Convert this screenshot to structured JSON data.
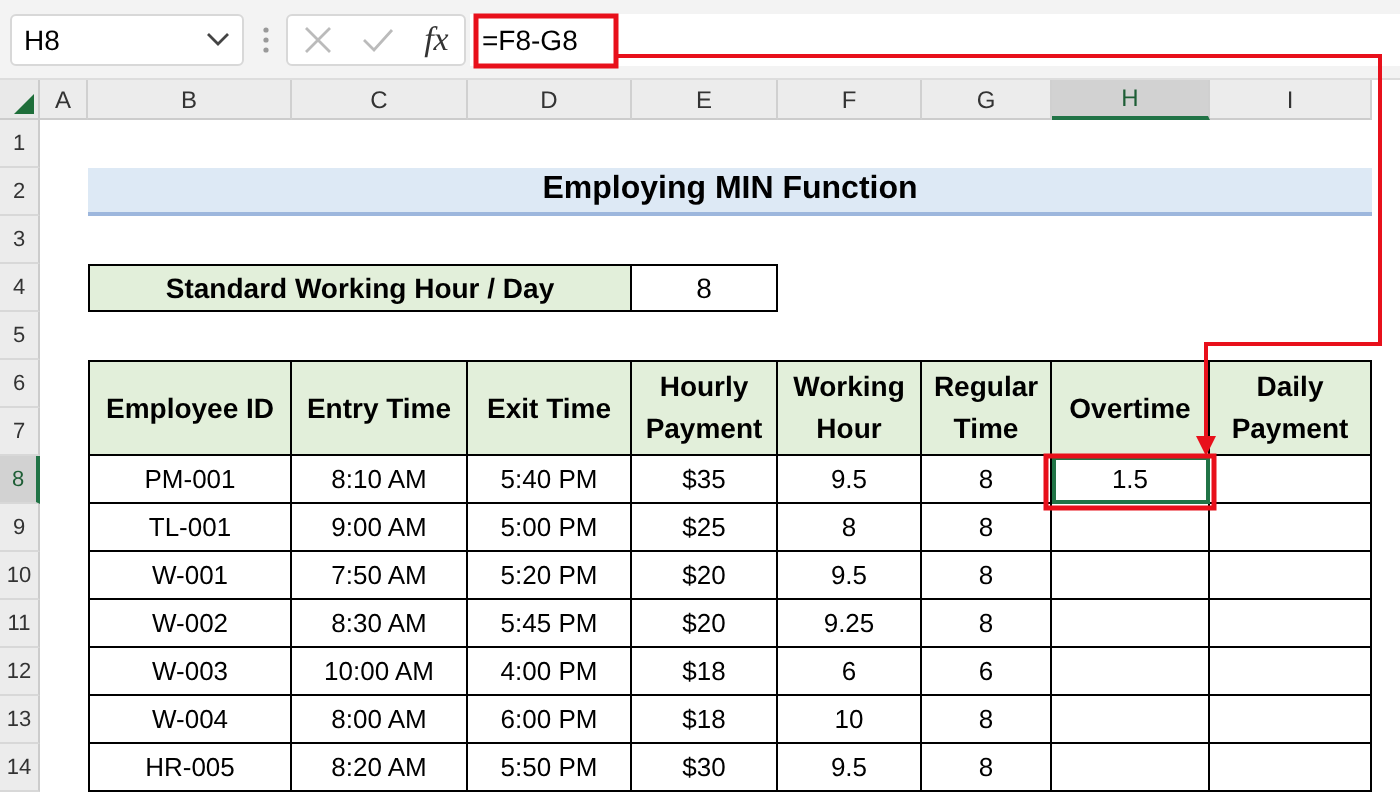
{
  "formula_bar": {
    "name_box": "H8",
    "function_label": "fx",
    "formula": "=F8-G8"
  },
  "columns": [
    {
      "label": "A",
      "selected": false
    },
    {
      "label": "B",
      "selected": false
    },
    {
      "label": "C",
      "selected": false
    },
    {
      "label": "D",
      "selected": false
    },
    {
      "label": "E",
      "selected": false
    },
    {
      "label": "F",
      "selected": false
    },
    {
      "label": "G",
      "selected": false
    },
    {
      "label": "H",
      "selected": true
    },
    {
      "label": "I",
      "selected": false
    }
  ],
  "row_numbers": [
    {
      "label": "1",
      "selected": false
    },
    {
      "label": "2",
      "selected": false
    },
    {
      "label": "3",
      "selected": false
    },
    {
      "label": "4",
      "selected": false
    },
    {
      "label": "5",
      "selected": false
    },
    {
      "label": "6",
      "selected": false
    },
    {
      "label": "7",
      "selected": false
    },
    {
      "label": "8",
      "selected": true
    },
    {
      "label": "9",
      "selected": false
    },
    {
      "label": "10",
      "selected": false
    },
    {
      "label": "11",
      "selected": false
    },
    {
      "label": "12",
      "selected": false
    },
    {
      "label": "13",
      "selected": false
    },
    {
      "label": "14",
      "selected": false
    }
  ],
  "title": "Employing MIN Function",
  "standard": {
    "label": "Standard Working Hour / Day",
    "value": "8"
  },
  "table": {
    "headers": [
      "Employee ID",
      "Entry Time",
      "Exit Time",
      "Hourly Payment",
      "Working Hour",
      "Regular Time",
      "Overtime",
      "Daily Payment"
    ],
    "rows": [
      {
        "id": "PM-001",
        "entry": "8:10 AM",
        "exit": "5:40 PM",
        "hourly": "$35",
        "working": "9.5",
        "regular": "8",
        "overtime": "1.5",
        "overtime_selected": true
      },
      {
        "id": "TL-001",
        "entry": "9:00 AM",
        "exit": "5:00 PM",
        "hourly": "$25",
        "working": "8",
        "regular": "8",
        "overtime_selected": false
      },
      {
        "id": "W-001",
        "entry": "7:50 AM",
        "exit": "5:20 PM",
        "hourly": "$20",
        "working": "9.5",
        "regular": "8",
        "overtime_selected": false
      },
      {
        "id": "W-002",
        "entry": "8:30 AM",
        "exit": "5:45 PM",
        "hourly": "$20",
        "working": "9.25",
        "regular": "8",
        "overtime_selected": false
      },
      {
        "id": "W-003",
        "entry": "10:00 AM",
        "exit": "4:00 PM",
        "hourly": "$18",
        "working": "6",
        "regular": "6",
        "overtime_selected": false
      },
      {
        "id": "W-004",
        "entry": "8:00 AM",
        "exit": "6:00 PM",
        "hourly": "$18",
        "working": "10",
        "regular": "8",
        "overtime_selected": false
      },
      {
        "id": "HR-005",
        "entry": "8:20 AM",
        "exit": "5:50 PM",
        "hourly": "$30",
        "working": "9.5",
        "regular": "8",
        "overtime_selected": false
      }
    ]
  }
}
